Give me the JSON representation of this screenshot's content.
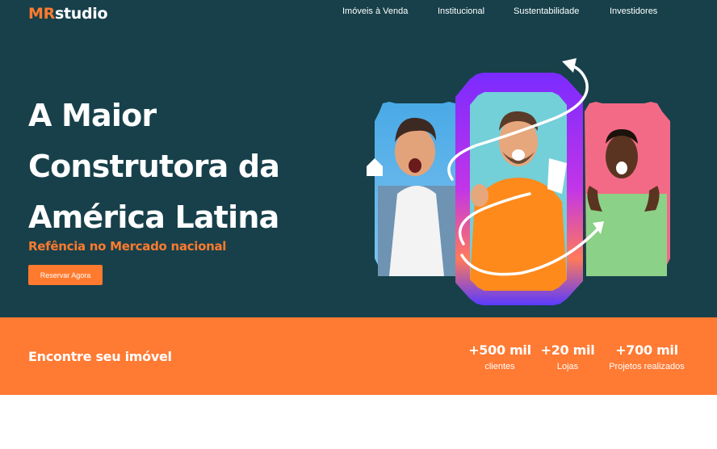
{
  "brand": {
    "prefix": "MR",
    "suffix": "studio",
    "accent": "#ff7a2e"
  },
  "nav": {
    "items": [
      "Imóveis à Venda",
      "Institucional",
      "Sustentabilidade",
      "Investidores"
    ]
  },
  "hero": {
    "headline": [
      "A Maior",
      "Construtora da",
      "América Latina"
    ],
    "subtitle": "Refência no Mercado nacional",
    "cta_label": "Reservar Agora",
    "background": "#17404a"
  },
  "band": {
    "title": "Encontre seu imóvel",
    "background": "#ff7a33",
    "stats": [
      {
        "value": "+500 mil",
        "label": "clientes"
      },
      {
        "value": "+20 mil",
        "label": "Lojas"
      },
      {
        "value": "+700 mil",
        "label": "Projetos realizados"
      }
    ]
  }
}
